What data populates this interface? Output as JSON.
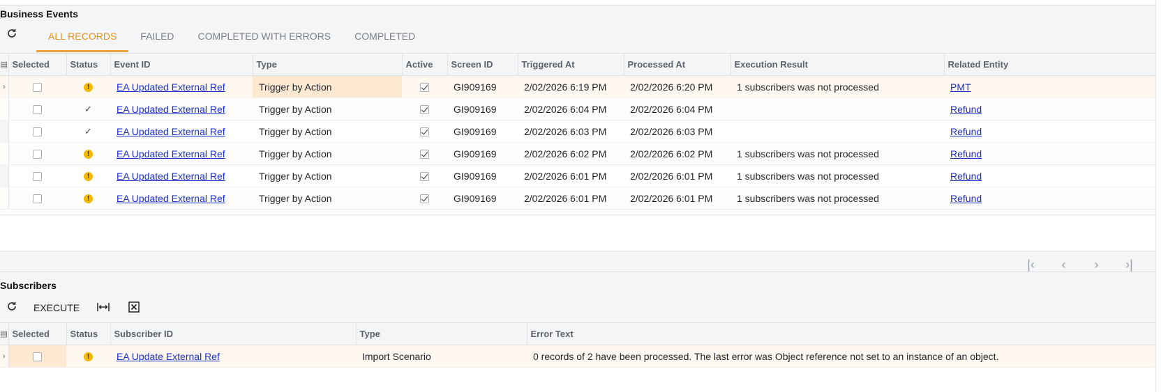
{
  "business_events": {
    "title": "Business Events",
    "tabs": [
      {
        "label": "ALL RECORDS",
        "active": true
      },
      {
        "label": "FAILED",
        "active": false
      },
      {
        "label": "COMPLETED WITH ERRORS",
        "active": false
      },
      {
        "label": "COMPLETED",
        "active": false
      }
    ],
    "columns": {
      "selected": "Selected",
      "status": "Status",
      "event_id": "Event ID",
      "type": "Type",
      "active": "Active",
      "screen_id": "Screen ID",
      "triggered_at": "Triggered At",
      "processed_at": "Processed At",
      "execution_result": "Execution Result",
      "related_entity": "Related Entity"
    },
    "rows": [
      {
        "status": "warning",
        "event_id": "EA Updated External Ref",
        "type": "Trigger by Action",
        "active": true,
        "screen_id": "GI909169",
        "triggered_at": "2/02/2026 6:19 PM",
        "processed_at": "2/02/2026 6:20 PM",
        "execution_result": "1 subscribers was not processed",
        "related_entity": "PMT"
      },
      {
        "status": "ok",
        "event_id": "EA Updated External Ref",
        "type": "Trigger by Action",
        "active": true,
        "screen_id": "GI909169",
        "triggered_at": "2/02/2026 6:04 PM",
        "processed_at": "2/02/2026 6:04 PM",
        "execution_result": "",
        "related_entity": "Refund"
      },
      {
        "status": "ok",
        "event_id": "EA Updated External Ref",
        "type": "Trigger by Action",
        "active": true,
        "screen_id": "GI909169",
        "triggered_at": "2/02/2026 6:03 PM",
        "processed_at": "2/02/2026 6:03 PM",
        "execution_result": "",
        "related_entity": "Refund"
      },
      {
        "status": "warning",
        "event_id": "EA Updated External Ref",
        "type": "Trigger by Action",
        "active": true,
        "screen_id": "GI909169",
        "triggered_at": "2/02/2026 6:02 PM",
        "processed_at": "2/02/2026 6:02 PM",
        "execution_result": "1 subscribers was not processed",
        "related_entity": "Refund"
      },
      {
        "status": "warning",
        "event_id": "EA Updated External Ref",
        "type": "Trigger by Action",
        "active": true,
        "screen_id": "GI909169",
        "triggered_at": "2/02/2026 6:01 PM",
        "processed_at": "2/02/2026 6:01 PM",
        "execution_result": "1 subscribers was not processed",
        "related_entity": "Refund"
      },
      {
        "status": "warning",
        "event_id": "EA Updated External Ref",
        "type": "Trigger by Action",
        "active": true,
        "screen_id": "GI909169",
        "triggered_at": "2/02/2026 6:01 PM",
        "processed_at": "2/02/2026 6:01 PM",
        "execution_result": "1 subscribers was not processed",
        "related_entity": "Refund"
      }
    ]
  },
  "subscribers": {
    "title": "Subscribers",
    "toolbar": {
      "execute_label": "EXECUTE"
    },
    "columns": {
      "selected": "Selected",
      "status": "Status",
      "subscriber_id": "Subscriber ID",
      "type": "Type",
      "error_text": "Error Text"
    },
    "rows": [
      {
        "selected": false,
        "status": "warning",
        "subscriber_id": "EA Update External Ref",
        "type": "Import Scenario",
        "error_text": "0 records of 2 have been processed. The last error was Object reference not set to an instance of an object."
      }
    ]
  },
  "icons": {
    "refresh": "refresh-icon",
    "fit_columns": "fit-columns-icon",
    "excel_export": "excel-export-icon",
    "warning": "warning-icon",
    "check": "check-icon",
    "pager": [
      "first-page-icon",
      "prev-page-icon",
      "next-page-icon",
      "last-page-icon"
    ]
  },
  "colors": {
    "accent": "#e69320",
    "link": "#1a2fc9",
    "warning": "#f5b800",
    "selected_row": "#fff8f0"
  }
}
